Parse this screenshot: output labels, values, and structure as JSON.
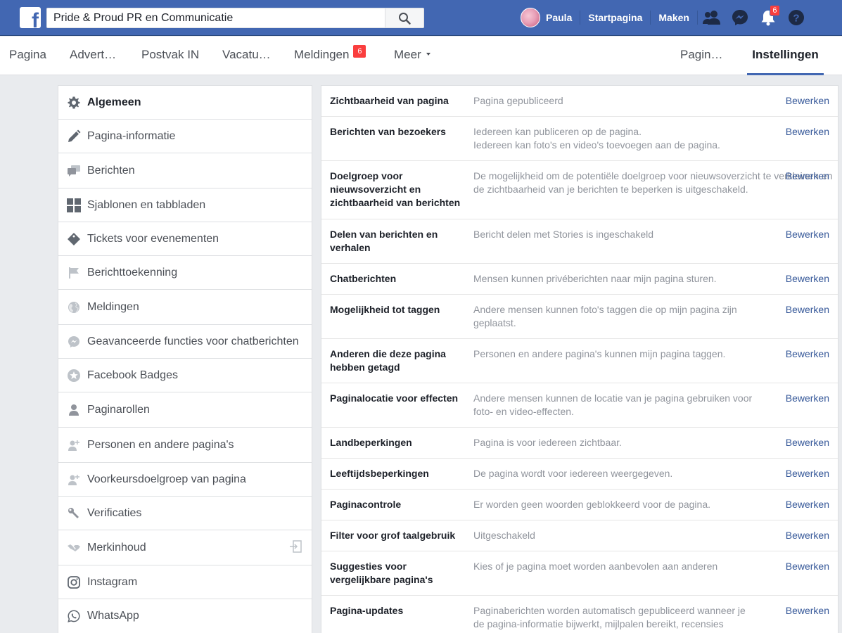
{
  "topbar": {
    "logo_letter": "f",
    "search_value": "Pride & Proud PR en Communicatie",
    "user_name": "Paula",
    "home_label": "Startpagina",
    "create_label": "Maken",
    "notifications_count": "6"
  },
  "pagenav": {
    "items": [
      {
        "label": "Pagina"
      },
      {
        "label": "Advert…"
      },
      {
        "label": "Postvak IN"
      },
      {
        "label": "Vacatu…"
      },
      {
        "label": "Meldingen",
        "badge": "6"
      },
      {
        "label": "Meer"
      },
      {
        "label": "Pagin…"
      },
      {
        "label": "Instellingen"
      }
    ]
  },
  "sidebar": {
    "items": [
      {
        "label": "Algemeen",
        "icon": "gear-icon"
      },
      {
        "label": "Pagina-informatie",
        "icon": "pencil-icon"
      },
      {
        "label": "Berichten",
        "icon": "chat-bubbles-icon"
      },
      {
        "label": "Sjablonen en tabbladen",
        "icon": "grid-icon"
      },
      {
        "label": "Tickets voor evenementen",
        "icon": "ticket-icon"
      },
      {
        "label": "Berichttoekenning",
        "icon": "flag-icon"
      },
      {
        "label": "Meldingen",
        "icon": "globe-icon"
      },
      {
        "label": "Geavanceerde functies voor chatberichten",
        "icon": "messenger-icon"
      },
      {
        "label": "Facebook Badges",
        "icon": "badge-icon"
      },
      {
        "label": "Paginarollen",
        "icon": "person-icon"
      },
      {
        "label": "Personen en andere pagina's",
        "icon": "person-plus-icon"
      },
      {
        "label": "Voorkeursdoelgroep van pagina",
        "icon": "person-plus-icon"
      },
      {
        "label": "Verificaties",
        "icon": "wrench-icon"
      },
      {
        "label": "Merkinhoud",
        "icon": "handshake-icon"
      },
      {
        "label": "Instagram",
        "icon": "instagram-icon"
      },
      {
        "label": "WhatsApp",
        "icon": "whatsapp-icon"
      }
    ]
  },
  "settings": {
    "edit_label": "Bewerken",
    "rows": [
      {
        "label": "Zichtbaarheid van pagina",
        "value": "Pagina gepubliceerd"
      },
      {
        "label": "Berichten van bezoekers",
        "value": "Iedereen kan publiceren op de pagina.\nIedereen kan foto's en video's toevoegen aan de pagina."
      },
      {
        "label": "Doelgroep voor nieuwsoverzicht en zichtbaarheid van berichten",
        "value": "De mogelijkheid om de potentiële doelgroep voor nieuwsoverzicht te verkleinen en de zichtbaarheid van je berichten te beperken is uitgeschakeld."
      },
      {
        "label": "Delen van berichten en verhalen",
        "value": "Bericht delen met Stories is ingeschakeld"
      },
      {
        "label": "Chatberichten",
        "value": "Mensen kunnen privéberichten naar mijn pagina sturen."
      },
      {
        "label": "Mogelijkheid tot taggen",
        "value": "Andere mensen kunnen foto's taggen die op mijn pagina zijn geplaatst."
      },
      {
        "label": "Anderen die deze pagina hebben getagd",
        "value": "Personen en andere pagina's kunnen mijn pagina taggen."
      },
      {
        "label": "Paginalocatie voor effecten",
        "value": "Andere mensen kunnen de locatie van je pagina gebruiken voor foto- en video-effecten."
      },
      {
        "label": "Landbeperkingen",
        "value": "Pagina is voor iedereen zichtbaar."
      },
      {
        "label": "Leeftijdsbeperkingen",
        "value": "De pagina wordt voor iedereen weergegeven."
      },
      {
        "label": "Paginacontrole",
        "value": "Er worden geen woorden geblokkeerd voor de pagina."
      },
      {
        "label": "Filter voor grof taalgebruik",
        "value": "Uitgeschakeld"
      },
      {
        "label": "Suggesties voor vergelijkbare pagina's",
        "value": "Kies of je pagina moet worden aanbevolen aan anderen"
      },
      {
        "label": "Pagina-updates",
        "value": "Paginaberichten worden automatisch gepubliceerd wanneer je de pagina-informatie bijwerkt, mijlpalen bereikt, recensies ontvangt en meer."
      }
    ]
  }
}
